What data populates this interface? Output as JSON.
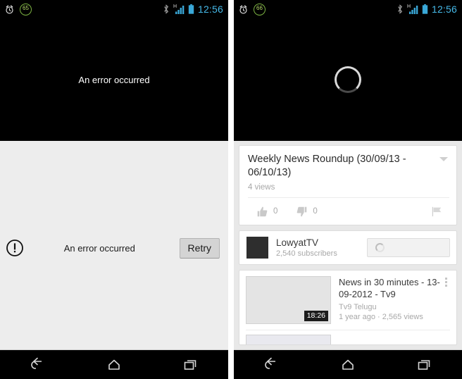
{
  "colors": {
    "clock_blue": "#46b9e8",
    "badge_green": "#7cb342",
    "player_black": "#000000",
    "panel_gray": "#ededed",
    "card_white": "#ffffff",
    "muted_text": "#a8a8a8"
  },
  "left_screen": {
    "status_bar": {
      "alarm_icon": "alarm-clock-icon",
      "notification_count": "65",
      "bluetooth_icon": "bluetooth-icon",
      "signal_label": "H",
      "signal_icon": "signal-bars-icon",
      "battery_icon": "battery-icon",
      "clock": "12:56"
    },
    "player": {
      "error_text": "An error occurred"
    },
    "error_row": {
      "icon": "error-exclamation-icon",
      "message": "An error occurred",
      "retry_label": "Retry"
    },
    "nav_bar": {
      "back_icon": "back-arrow-icon",
      "home_icon": "home-icon",
      "recents_icon": "recent-apps-icon"
    }
  },
  "right_screen": {
    "status_bar": {
      "alarm_icon": "alarm-clock-icon",
      "notification_count": "66",
      "bluetooth_icon": "bluetooth-icon",
      "signal_label": "H",
      "signal_icon": "signal-bars-icon",
      "battery_icon": "battery-icon",
      "clock": "12:56"
    },
    "player": {
      "loading_icon": "loading-spinner-icon"
    },
    "video_card": {
      "title": "Weekly News Roundup (30/09/13 - 06/10/13)",
      "views": "4 views",
      "expand_icon": "chevron-down-icon",
      "like_icon": "thumbs-up-icon",
      "like_count": "0",
      "dislike_icon": "thumbs-down-icon",
      "dislike_count": "0",
      "flag_icon": "flag-icon"
    },
    "channel_card": {
      "avatar": "channel-avatar",
      "name": "LowyatTV",
      "subscribers": "2,540 subscribers",
      "subscribe_loading_icon": "loading-spinner-icon"
    },
    "related": [
      {
        "title": "News in 30 minutes - 13-09-2012 - Tv9",
        "channel": "Tv9 Telugu",
        "stats": "1 year ago · 2,565 views",
        "duration": "18:26",
        "overflow_icon": "overflow-menu-icon"
      }
    ],
    "nav_bar": {
      "back_icon": "back-arrow-icon",
      "home_icon": "home-icon",
      "recents_icon": "recent-apps-icon"
    }
  }
}
